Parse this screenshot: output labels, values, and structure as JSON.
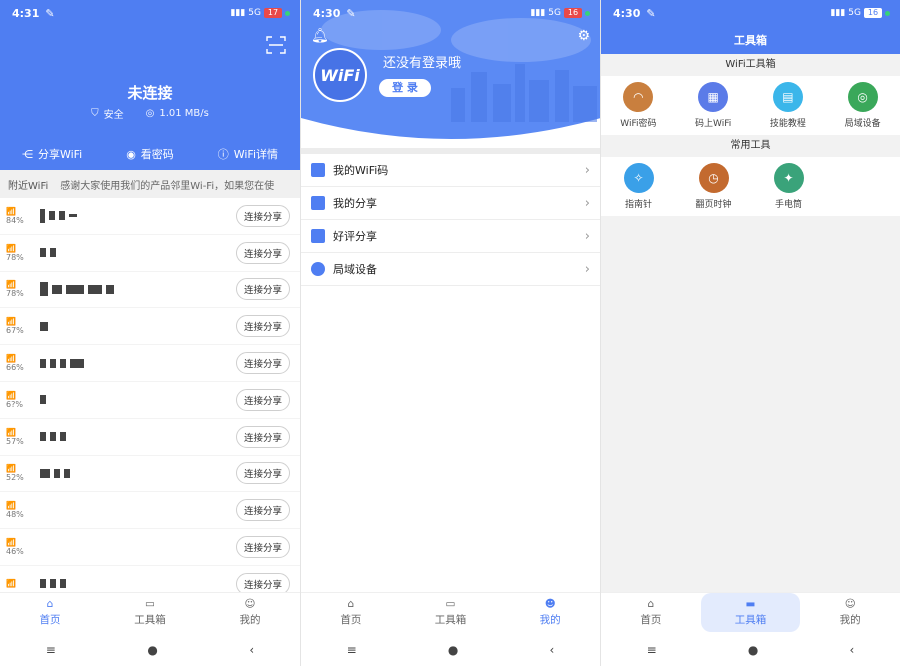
{
  "screen1": {
    "status": {
      "time": "4:31",
      "network": "5G",
      "battery": "17"
    },
    "connection_title": "未连接",
    "security_label": "安全",
    "speed_label": "1.01 MB/s",
    "actions": [
      "分享WiFi",
      "看密码",
      "WiFi详情"
    ],
    "nearby_label": "附近WiFi",
    "marquee": "感谢大家使用我们的产品邻里Wi-Fi，如果您在使",
    "connect_label": "连接分享",
    "wifi_rows": [
      {
        "signal": "84%"
      },
      {
        "signal": "78%"
      },
      {
        "signal": "78%"
      },
      {
        "signal": "67%"
      },
      {
        "signal": "66%"
      },
      {
        "signal": "6?%"
      },
      {
        "signal": "57%"
      },
      {
        "signal": "52%"
      },
      {
        "signal": "48%"
      },
      {
        "signal": "46%"
      },
      {
        "signal": ""
      }
    ],
    "nav": [
      "首页",
      "工具箱",
      "我的"
    ]
  },
  "screen2": {
    "status": {
      "time": "4:30",
      "network": "5G",
      "battery": "16"
    },
    "logo_text": "WiFi",
    "login_title": "还没有登录哦",
    "login_button": "登 录",
    "menu": [
      {
        "label": "我的WiFi码",
        "color": "#4f7ef2"
      },
      {
        "label": "我的分享",
        "color": "#4f7ef2"
      },
      {
        "label": "好评分享",
        "color": "#4f7ef2"
      },
      {
        "label": "局域设备",
        "color": "#4f7ef2"
      }
    ],
    "nav": [
      "首页",
      "工具箱",
      "我的"
    ]
  },
  "screen3": {
    "status": {
      "time": "4:30",
      "network": "5G",
      "battery": "16"
    },
    "title": "工具箱",
    "section1_title": "WiFi工具箱",
    "section1_tools": [
      {
        "label": "WiFi密码",
        "color": "#c97f3e"
      },
      {
        "label": "码上WiFi",
        "color": "#5b7be8"
      },
      {
        "label": "技能教程",
        "color": "#3bb6ea"
      },
      {
        "label": "局域设备",
        "color": "#3aa85a"
      }
    ],
    "section2_title": "常用工具",
    "section2_tools": [
      {
        "label": "指南针",
        "color": "#3aa0e8"
      },
      {
        "label": "翻页时钟",
        "color": "#c36a2f"
      },
      {
        "label": "手电筒",
        "color": "#3aa37a"
      }
    ],
    "nav": [
      "首页",
      "工具箱",
      "我的"
    ]
  }
}
